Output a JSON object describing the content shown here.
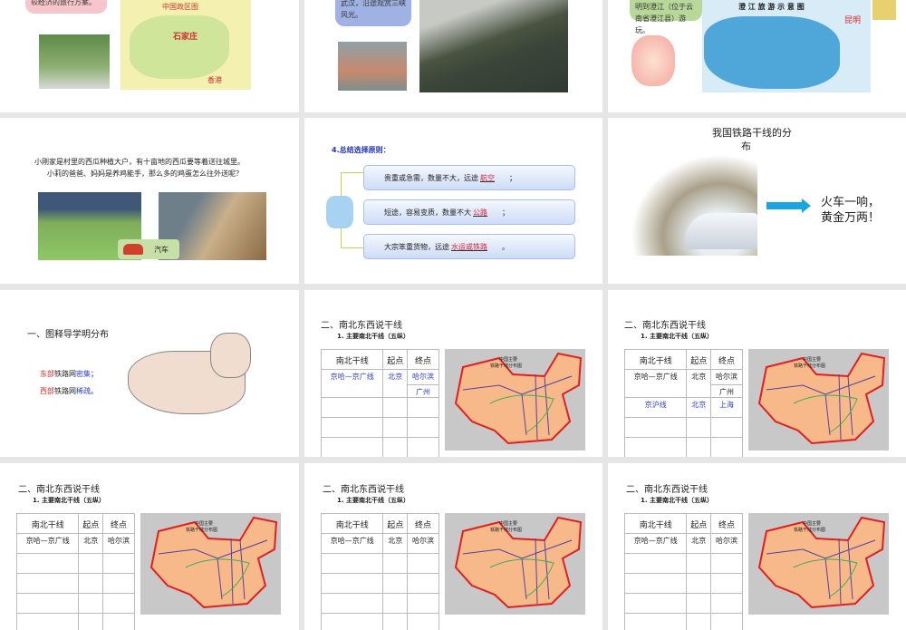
{
  "slides": {
    "s1": {
      "bubble_text": "较经济的旅行方案。",
      "map_title": "中国政区图",
      "city_a": "石家庄",
      "city_b": "香港"
    },
    "s2": {
      "bubble_text": "武汉，沿途观赏三峡风光。"
    },
    "s3": {
      "bubble_text": "明到澄江（位于云南省澄江县）游玩。",
      "map_title": "澄 江 旅 游 示 意 图",
      "city": "昆明"
    },
    "s4": {
      "line1": "小刚家是村里的西瓜种植大户，有十亩地的西瓜要等着送往城里。",
      "line2": "小莉的爸爸、妈妈是养鸡能手，那么多的鸡蛋怎么往外送呢？",
      "car_label": "汽车"
    },
    "s5": {
      "title": "4.总结选择原则：",
      "rows": [
        {
          "text": "贵重或急需，数量不大，远途",
          "answer": "航空",
          "end": "；"
        },
        {
          "text": "短途，容易变质，数量不大",
          "answer": "公路",
          "end": "；"
        },
        {
          "text": "大宗笨重货物，远途",
          "answer": "水运或铁路",
          "end": "。"
        }
      ]
    },
    "s6": {
      "title_line1": "我国铁路干线的分",
      "title_line2": "布",
      "slogan_line1": "火车一响，",
      "slogan_line2": "黄金万两！"
    },
    "s7": {
      "title": "一、图释导学明分布",
      "east_a": "东部",
      "east_b": "铁路网",
      "east_c": "密集",
      "east_d": "；",
      "west_a": "西部",
      "west_b": "铁路网",
      "west_c": "稀疏",
      "west_d": "。"
    },
    "table_slide": {
      "title": "二、南北东西说干线",
      "subtitle": "1. 主要南北干线（五纵）",
      "headers": [
        "南北干线",
        "起点",
        "终点"
      ],
      "map_title_1": "中国主要",
      "map_title_2": "铁路干线分布图"
    },
    "s8_rows": [
      {
        "line": "京哈—京广线",
        "start": "北京",
        "end1": "哈尔滨",
        "end2": "广州"
      }
    ],
    "s9_rows": [
      {
        "line": "京哈—京广线",
        "start": "北京",
        "end1": "哈尔滨",
        "end2": "广州"
      },
      {
        "line": "京沪线",
        "start": "北京",
        "end1": "上海"
      }
    ],
    "bottom_rows": [
      {
        "line": "京哈—京广线",
        "start": "北京",
        "end1": "哈尔滨"
      }
    ]
  },
  "colors": {
    "gap": "#e6e6e6",
    "answer": "#e0203a",
    "blue_text": "#2a3cc9",
    "arrow": "#1aa5e0"
  }
}
